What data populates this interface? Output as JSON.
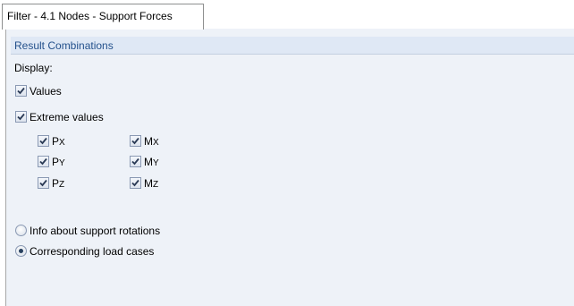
{
  "tab": {
    "label": "Filter - 4.1 Nodes - Support Forces"
  },
  "section": {
    "title": "Result Combinations"
  },
  "display": {
    "label": "Display:"
  },
  "values_option": {
    "label": "Values",
    "checked": true
  },
  "extreme_option": {
    "label": "Extreme values",
    "checked": true
  },
  "components": {
    "px": {
      "base": "P",
      "sub": "X",
      "checked": true
    },
    "py": {
      "base": "P",
      "sub": "Y",
      "checked": true
    },
    "pz": {
      "base": "P",
      "sub": "Z",
      "checked": true
    },
    "mx": {
      "base": "M",
      "sub": "X",
      "checked": true
    },
    "my": {
      "base": "M",
      "sub": "Y",
      "checked": true
    },
    "mz": {
      "base": "M",
      "sub": "Z",
      "checked": true
    }
  },
  "radio_options": {
    "info_rotations": {
      "label": "Info about support rotations",
      "selected": false
    },
    "corresponding_cases": {
      "label": "Corresponding load cases",
      "selected": true
    }
  },
  "colors": {
    "panel_bg": "#eef2f8",
    "header_bg": "#dfe8f5",
    "header_text": "#24518c",
    "check_mark": "#2a3a55"
  }
}
